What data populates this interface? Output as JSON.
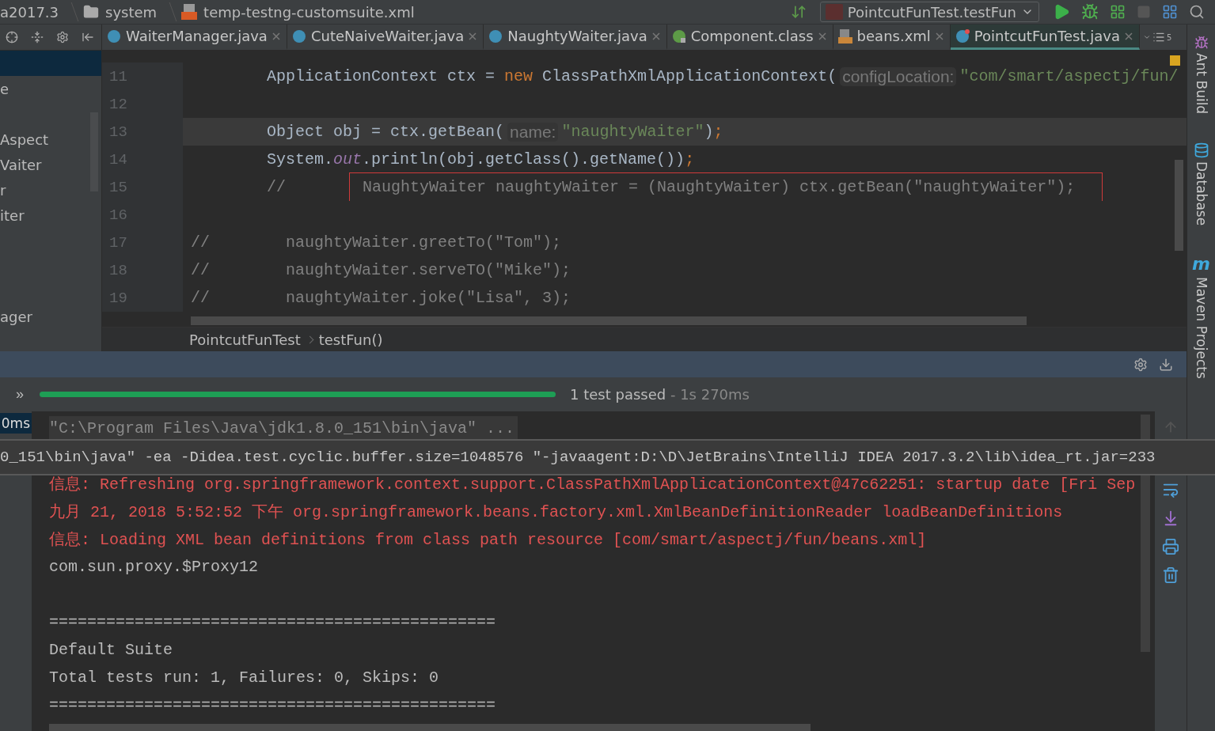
{
  "breadcrumb": [
    {
      "text": "a2017.3",
      "kind": "module"
    },
    {
      "text": "system",
      "kind": "folder"
    },
    {
      "text": "temp-testng-customsuite.xml",
      "kind": "xml"
    }
  ],
  "run_config": {
    "label": "PointcutFunTest.testFun"
  },
  "stop_button": {
    "disabled": true
  },
  "tabs": [
    {
      "label": "WaiterManager.java",
      "kind": "class",
      "selected": false
    },
    {
      "label": "CuteNaiveWaiter.java",
      "kind": "class",
      "selected": false
    },
    {
      "label": "NaughtyWaiter.java",
      "kind": "class",
      "selected": false
    },
    {
      "label": "Component.class",
      "kind": "annotation",
      "selected": false
    },
    {
      "label": "beans.xml",
      "kind": "xml",
      "selected": false
    },
    {
      "label": "PointcutFunTest.java",
      "kind": "test",
      "selected": true
    }
  ],
  "tabs_overflow": "5",
  "project_tree": [
    {
      "label": "e"
    },
    {
      "label": "Aspect"
    },
    {
      "label": "Vaiter"
    },
    {
      "label": "r"
    },
    {
      "label": "iter"
    },
    {
      "label": "ager"
    }
  ],
  "code": [
    {
      "line": "11",
      "current": false,
      "tokens": [
        {
          "kind": "plain",
          "text": "        ApplicationContext ctx = "
        },
        {
          "kind": "keyword",
          "text": "new"
        },
        {
          "kind": "plain",
          "text": " ClassPathXmlApplicationContext("
        },
        {
          "kind": "hint",
          "text": "configLocation:"
        },
        {
          "kind": "string",
          "text": "\"com/smart/aspectj/fun/"
        }
      ]
    },
    {
      "line": "12",
      "current": false
    },
    {
      "line": "13",
      "current": true,
      "tokens": [
        {
          "kind": "plain",
          "text": "        Object obj = ctx.getBean("
        },
        {
          "kind": "hint",
          "text": "name:"
        },
        {
          "kind": "string",
          "text": "\"naughtyWaiter\""
        },
        {
          "kind": "plain",
          "text": ")"
        },
        {
          "kind": "keyword",
          "text": ";"
        }
      ]
    },
    {
      "line": "14",
      "current": false,
      "tokens": [
        {
          "kind": "plain",
          "text": "        System."
        },
        {
          "kind": "field",
          "text": "out"
        },
        {
          "kind": "plain",
          "text": ".println(obj.getClass().getName())"
        },
        {
          "kind": "keyword",
          "text": ";"
        }
      ]
    },
    {
      "line": "15",
      "current": false,
      "tokens": [
        {
          "kind": "comment",
          "text": "        //"
        },
        {
          "kind": "boxed",
          "text": "NaughtyWaiter naughtyWaiter = (NaughtyWaiter) ctx.getBean(\"naughtyWaiter\");"
        }
      ]
    },
    {
      "line": "16",
      "current": false
    },
    {
      "line": "17",
      "current": false,
      "tokens": [
        {
          "kind": "comment",
          "text": "//        naughtyWaiter.greetTo(\"Tom\");"
        }
      ]
    },
    {
      "line": "18",
      "current": false,
      "tokens": [
        {
          "kind": "comment",
          "text": "//        naughtyWaiter.serveTO(\"Mike\");"
        }
      ]
    },
    {
      "line": "19",
      "current": false,
      "tokens": [
        {
          "kind": "comment",
          "text": "//        naughtyWaiter.joke(\"Lisa\", 3);"
        }
      ]
    }
  ],
  "editor_breadcrumb": [
    "PointcutFunTest",
    "testFun()"
  ],
  "run": {
    "collapse": "»",
    "progress": {
      "level": 1
    },
    "status": "1 test passed",
    "duration": " - 1s 270ms",
    "tree_item": "0ms"
  },
  "console": [
    {
      "kind": "folded",
      "text": "\"C:\\Program Files\\Java\\jdk1.8.0_151\\bin\\java\" ..."
    },
    {
      "kind": "hidden"
    },
    {
      "kind": "error",
      "text": "信息: Refreshing org.springframework.context.support.ClassPathXmlApplicationContext@47c62251: startup date [Fri Sep"
    },
    {
      "kind": "error",
      "text": "九月 21, 2018 5:52:52 下午 org.springframework.beans.factory.xml.XmlBeanDefinitionReader loadBeanDefinitions"
    },
    {
      "kind": "error",
      "text": "信息: Loading XML bean definitions from class path resource [com/smart/aspectj/fun/beans.xml]"
    },
    {
      "kind": "output",
      "text": "com.sun.proxy.$Proxy12"
    },
    {
      "kind": "blank"
    },
    {
      "kind": "output",
      "text": "==============================================="
    },
    {
      "kind": "output",
      "text": "Default Suite"
    },
    {
      "kind": "output",
      "text": "Total tests run: 1, Failures: 0, Skips: 0"
    },
    {
      "kind": "output",
      "text": "==============================================="
    }
  ],
  "tooltip": {
    "text": "0_151\\bin\\java\" -ea -Didea.test.cyclic.buffer.size=1048576 \"-javaagent:D:\\D\\JetBrains\\IntelliJ IDEA 2017.3.2\\lib\\idea_rt.jar=233"
  },
  "tool_windows": [
    {
      "label": "Ant Build",
      "kind": "ant"
    },
    {
      "label": "Database",
      "kind": "database"
    },
    {
      "label": "Maven Projects",
      "kind": "maven",
      "icon_text": "m"
    }
  ]
}
